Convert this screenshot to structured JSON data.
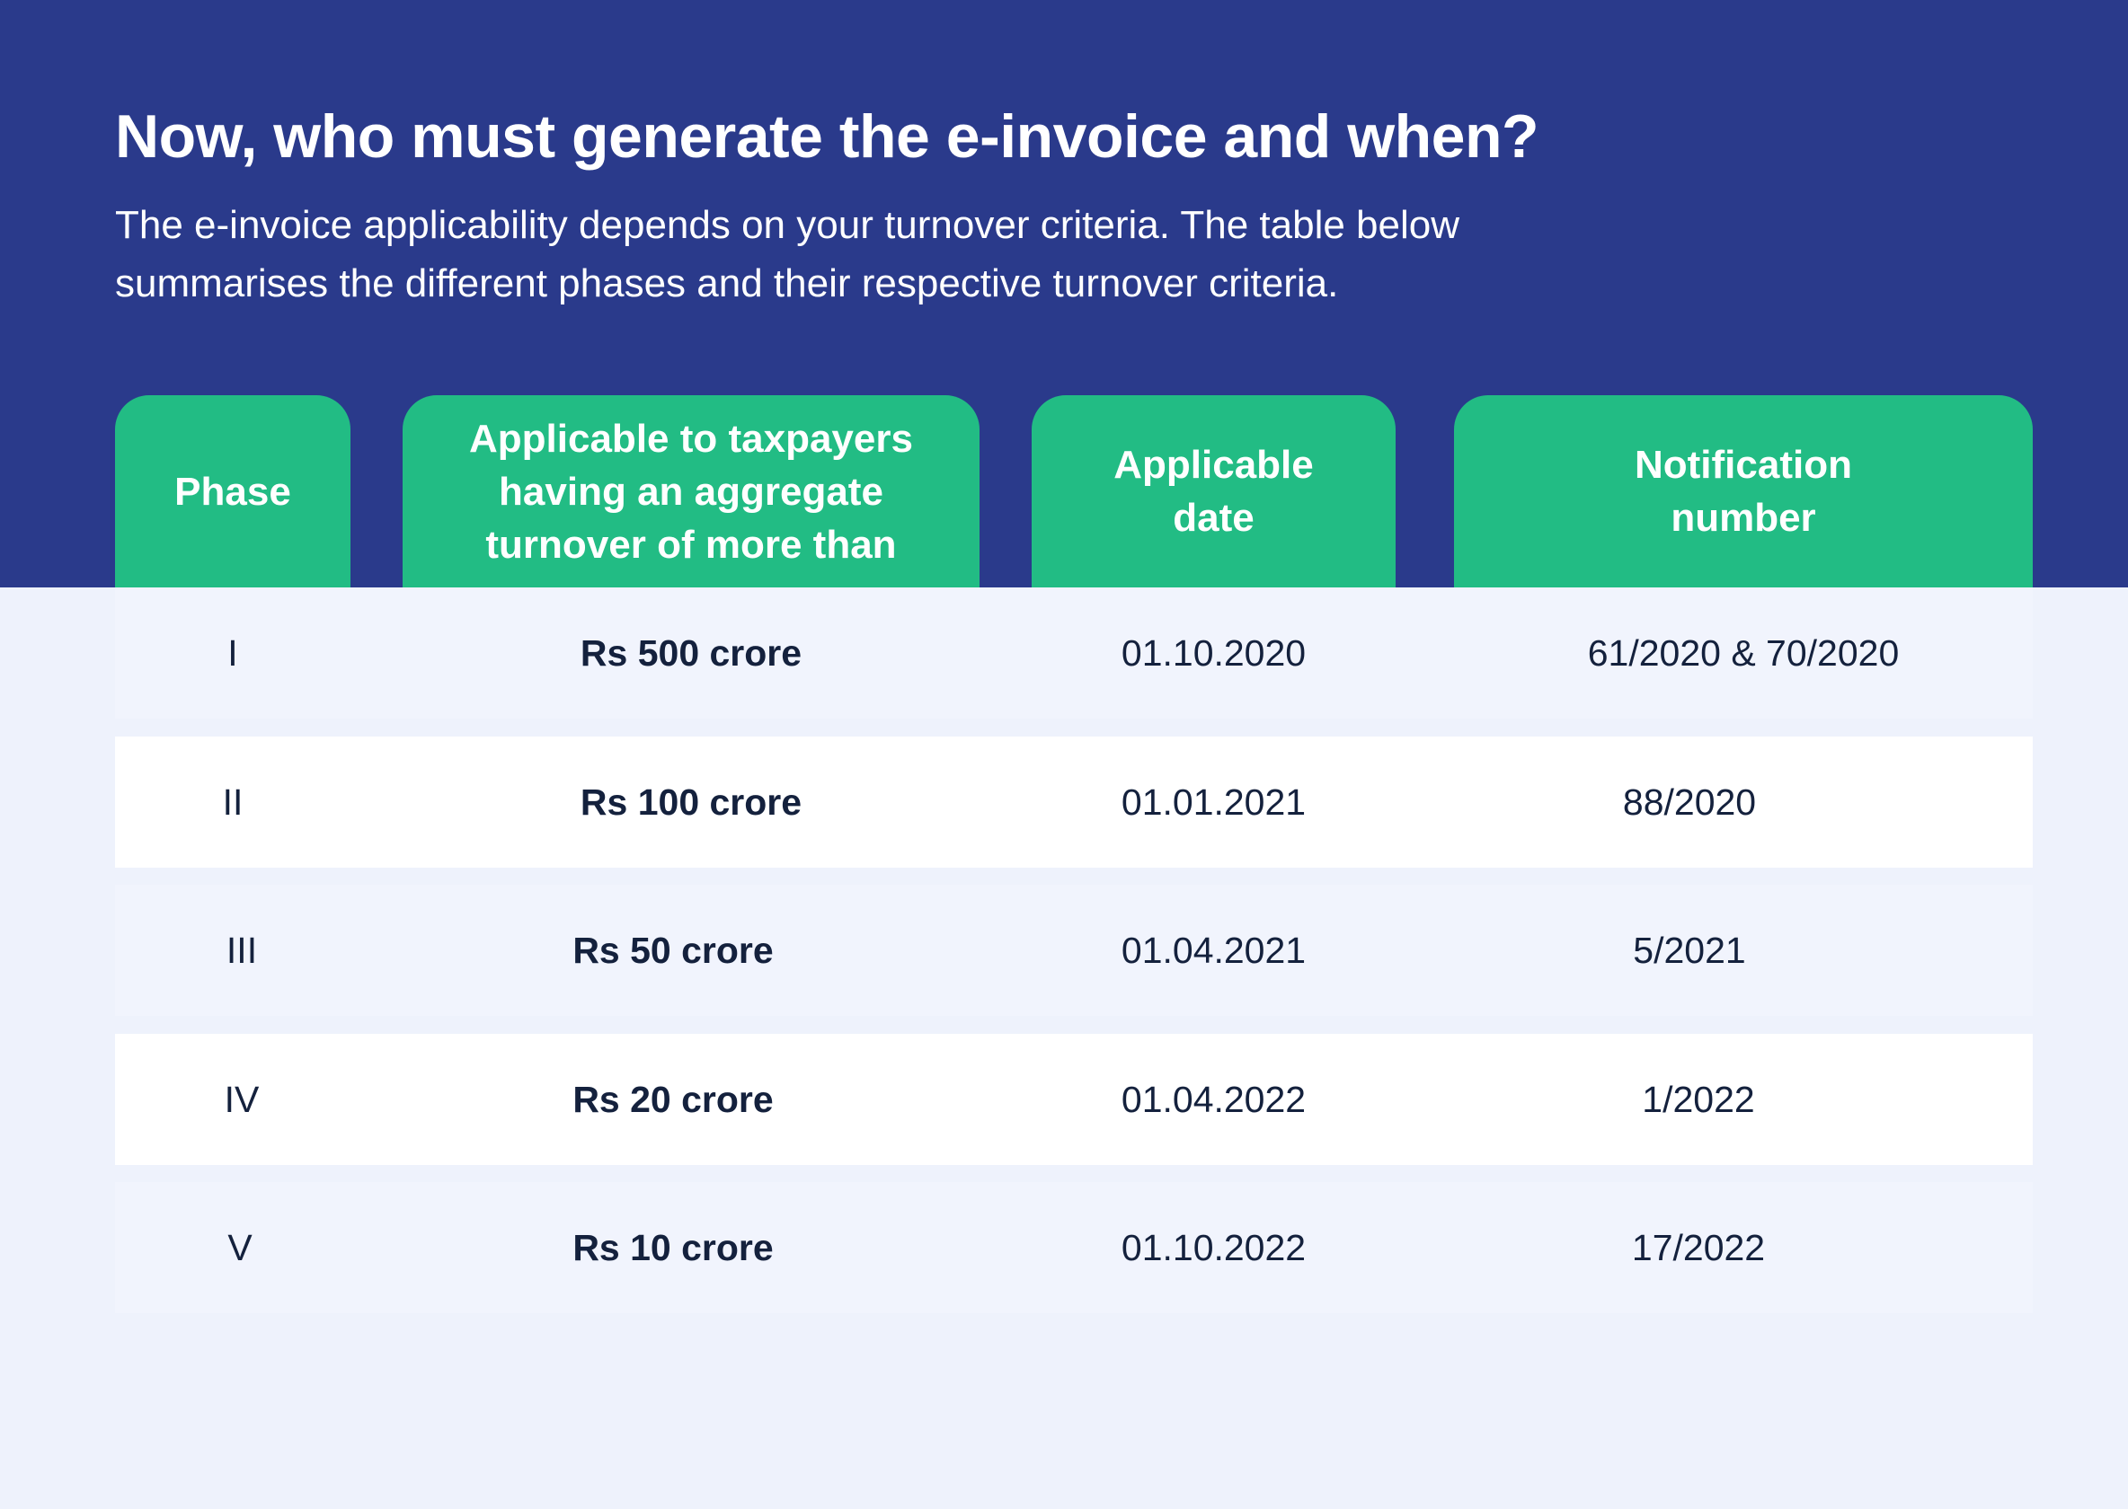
{
  "header": {
    "title": "Now, who must generate the e-invoice and when?",
    "subtitle": "The e-invoice applicability depends on your turnover criteria. The table below summarises the different phases and their respective turnover criteria."
  },
  "table": {
    "columns": [
      {
        "lines": [
          "Phase"
        ]
      },
      {
        "lines": [
          "Applicable to taxpayers",
          "having an aggregate",
          "turnover of more than"
        ]
      },
      {
        "lines": [
          "Applicable",
          "date"
        ]
      },
      {
        "lines": [
          "Notification",
          "number"
        ]
      }
    ],
    "rows": [
      {
        "phase": "I",
        "turnover": "Rs 500 crore",
        "date": "01.10.2020",
        "notification": "61/2020 & 70/2020"
      },
      {
        "phase": "II",
        "turnover": "Rs 100 crore",
        "date": "01.01.2021",
        "notification": "88/2020"
      },
      {
        "phase": "III",
        "turnover": "Rs 50 crore",
        "date": "01.04.2021",
        "notification": "5/2021"
      },
      {
        "phase": "IV",
        "turnover": "Rs 20 crore",
        "date": "01.04.2022",
        "notification": "1/2022"
      },
      {
        "phase": "V",
        "turnover": "Rs 10 crore",
        "date": "01.10.2022",
        "notification": "17/2022"
      }
    ]
  },
  "colors": {
    "hero_background": "#2a3a8b",
    "header_cell": "#22bc84",
    "row_alt": "#f1f4fd",
    "row": "#ffffff",
    "text_dark": "#14213d"
  }
}
